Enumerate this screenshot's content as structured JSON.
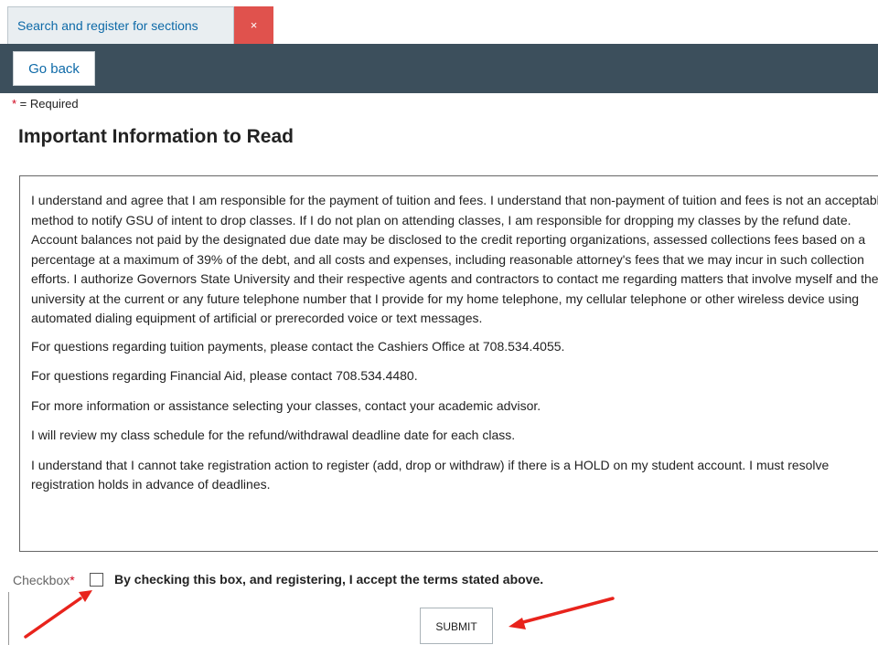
{
  "tab": {
    "label": "Search and register for sections",
    "close_label": "×"
  },
  "toolbar": {
    "go_back_label": "Go back"
  },
  "form": {
    "required_star": "*",
    "required_text": " = Required",
    "heading": "Important Information to Read",
    "paragraphs": [
      "I understand and agree that I am responsible for the payment of tuition and fees. I understand that non-payment of tuition and fees is not an acceptable method to notify GSU of intent to drop classes. If I do not plan on attending classes, I am responsible for dropping my classes by the refund date. Account balances not paid by the designated due date may be disclosed to the credit reporting organizations, assessed collections fees based on a percentage at a maximum of 39% of the debt, and all costs and expenses, including reasonable attorney's fees that we may incur in such collection efforts. I authorize Governors State University and their respective agents and contractors to contact me regarding matters that involve myself and the university at the current or any future telephone number that I provide for my home telephone, my cellular telephone or other wireless device using automated dialing equipment of artificial or prerecorded voice or text messages.",
      "For questions regarding tuition payments, please contact the Cashiers Office at 708.534.4055.",
      "For questions regarding Financial Aid, please contact 708.534.4480.",
      "For more information or assistance selecting your classes, contact your academic advisor.",
      "I will review my class schedule for the refund/withdrawal deadline date for each class.",
      "I understand that I cannot take registration action to register (add, drop or withdraw) if there is a HOLD on my student account. I must resolve registration holds in advance of deadlines."
    ],
    "checkbox_label": "Checkbox",
    "checkbox_star": "*",
    "checkbox_checked": false,
    "terms_text": "By checking this box, and registering, I accept the terms stated above.",
    "submit_label": "SUBMIT"
  },
  "colors": {
    "toolbar_bg": "#3c4f5c",
    "tab_close_bg": "#e0524d",
    "link_blue": "#0e6aa8",
    "required_red": "#d0021b",
    "annotation_arrow": "#e8231c"
  }
}
